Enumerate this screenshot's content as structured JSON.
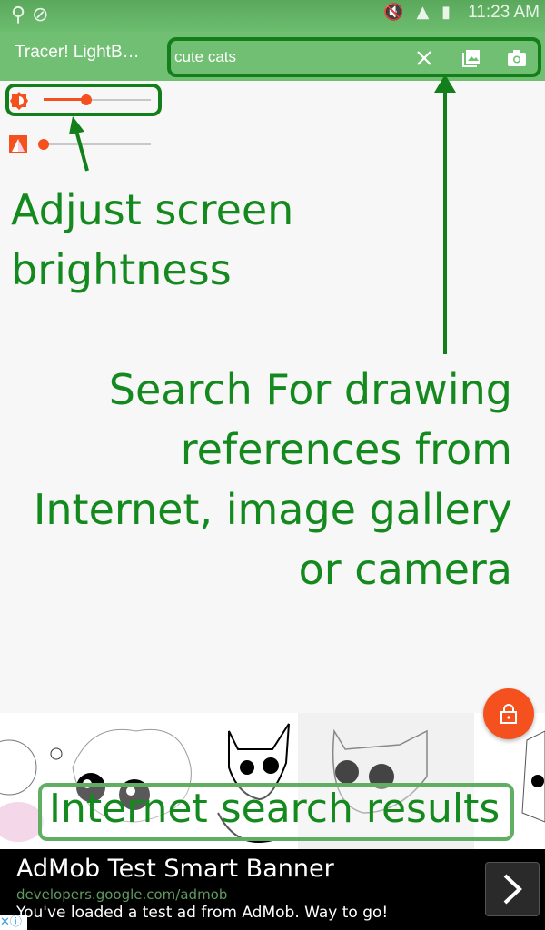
{
  "status_bar": {
    "time": "11:23 AM",
    "icons": [
      "usb-icon",
      "blocked-icon",
      "mute-icon",
      "wifi-icon",
      "signal-icon",
      "battery-icon"
    ]
  },
  "app_bar": {
    "title": "Tracer! LightB…",
    "search": {
      "value": "cute cats",
      "placeholder": ""
    },
    "buttons": [
      "clear-icon",
      "gallery-icon",
      "camera-icon"
    ]
  },
  "sliders": {
    "brightness": {
      "icon": "brightness-icon",
      "value_percent": 38
    },
    "opacity": {
      "icon": "opacity-icon",
      "value_percent": 0
    }
  },
  "annotations": {
    "brightness": [
      "Adjust screen",
      "brightness"
    ],
    "search": [
      "Search For drawing",
      "references from",
      "Internet, image gallery",
      "or camera"
    ],
    "results": "Internet search results"
  },
  "fab": {
    "icon": "lock-icon"
  },
  "ad": {
    "headline": "AdMob Test Smart Banner",
    "url": "developers.google.com/admob",
    "description": "You've loaded a test ad from AdMob. Way to go!"
  },
  "colors": {
    "primary": "#70bf72",
    "accent": "#f4511e",
    "annotation": "#148a1e"
  }
}
